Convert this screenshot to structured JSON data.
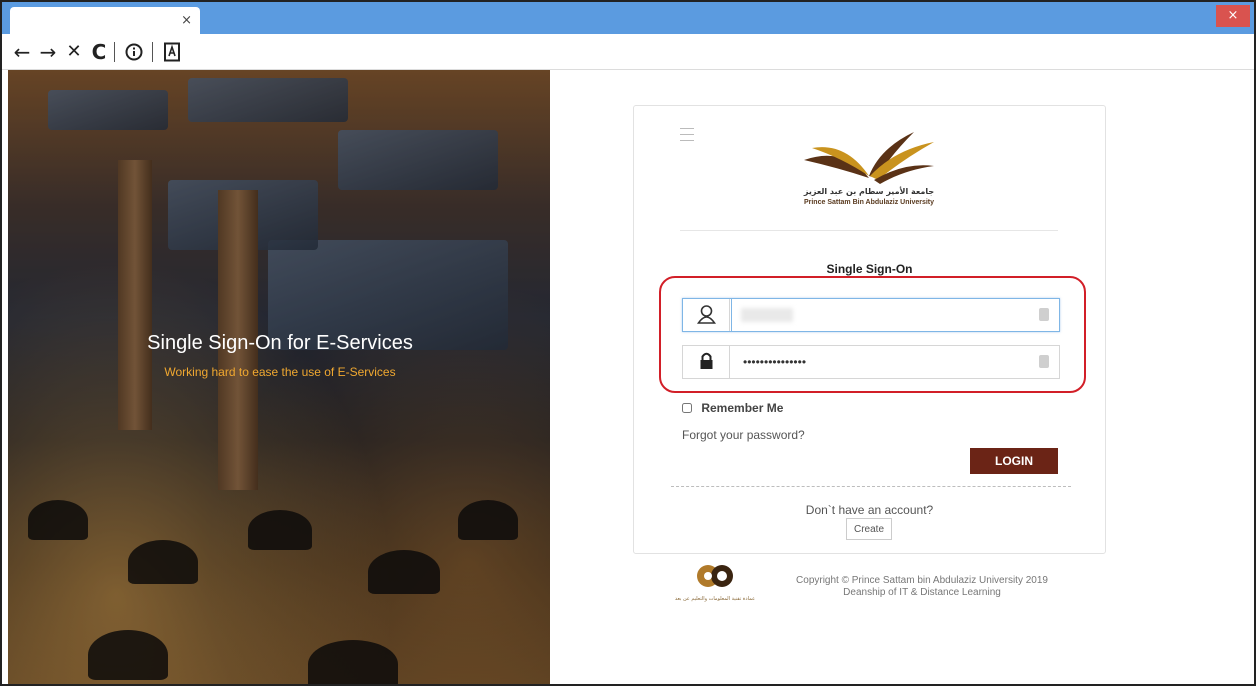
{
  "browser": {
    "tab_close": "×",
    "window_close": "×",
    "nav": {
      "back": "←",
      "forward": "→",
      "stop": "✕",
      "reload": "C"
    }
  },
  "hero": {
    "title": "Single Sign-On for E-Services",
    "subtitle": "Working hard to ease the use of E-Services"
  },
  "logo": {
    "arabic": "جامعة الأمير سطام بن عبد العزيز",
    "english": "Prince Sattam Bin Abdulaziz University"
  },
  "login": {
    "title": "Single Sign-On",
    "password_mask": "•••••••••••••••",
    "remember_label": "Remember Me",
    "forgot_link": "Forgot your password?",
    "login_button": "LOGIN",
    "no_account": "Don`t have an account?",
    "create_button": "Create"
  },
  "footer": {
    "deanship_logo_text": "عمادة تقنية المعلومات والتعليم عن بعد",
    "copyright_line1": "Copyright © Prince Sattam bin Abdulaziz University 2019",
    "copyright_line2": "Deanship of IT & Distance Learning"
  },
  "colors": {
    "titlebar": "#5b9be0",
    "login_button": "#6b2416",
    "highlight": "#d21f28",
    "hero_subtitle": "#f0a830"
  }
}
